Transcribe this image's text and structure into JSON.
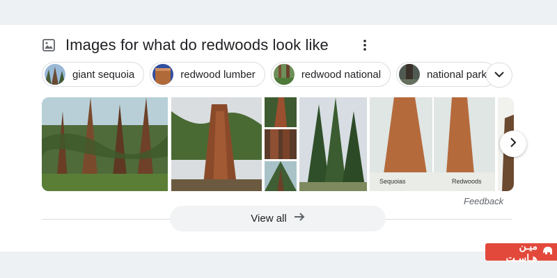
{
  "section": {
    "title": "Images for what do redwoods look like",
    "icon": "image-icon",
    "more_icon": "more-vert-icon"
  },
  "chips": [
    {
      "label": "giant sequoia"
    },
    {
      "label": "redwood lumber"
    },
    {
      "label": "redwood national"
    },
    {
      "label": "national park"
    }
  ],
  "chip_expand_icon": "chevron-down-icon",
  "images": [
    {
      "caption": ""
    },
    {
      "caption": ""
    },
    {
      "caption": "Sequoias",
      "caption2": "Redwoods"
    }
  ],
  "next_icon": "chevron-right-icon",
  "feedback": "Feedback",
  "view_all": {
    "label": "View all",
    "icon": "arrow-right-icon"
  },
  "watermark": {
    "text": "میـن هـاسـت"
  },
  "colors": {
    "accent": "#1a73e8",
    "text": "#202124",
    "muted": "#5f6368",
    "border": "#dadce0",
    "watermark": "#e3493b"
  }
}
